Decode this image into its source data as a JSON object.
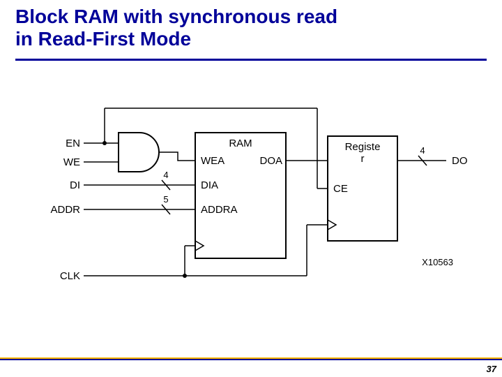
{
  "title_line1": "Block RAM with synchronous read",
  "title_line2": "in Read-First Mode",
  "page_number": "37",
  "diagram": {
    "ram_block_label": "RAM",
    "reg_block_label_line1": "Registe",
    "reg_block_label_line2": "r",
    "inputs": {
      "en": "EN",
      "we": "WE",
      "di": "DI",
      "addr": "ADDR",
      "clk": "CLK"
    },
    "ram_ports": {
      "wea": "WEA",
      "doa": "DOA",
      "dia": "DIA",
      "addra": "ADDRA"
    },
    "reg_ports": {
      "ce": "CE"
    },
    "output": "DO",
    "bus_widths": {
      "di": "4",
      "addr": "5",
      "do": "4"
    },
    "figure_id": "X10563"
  }
}
